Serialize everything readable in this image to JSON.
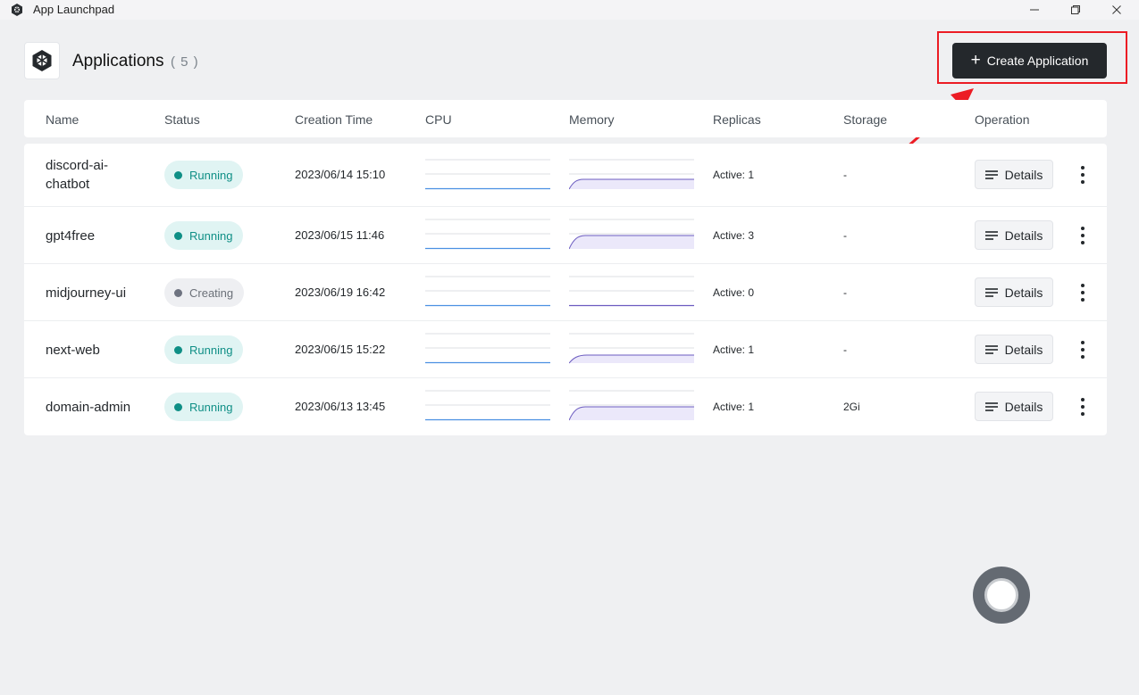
{
  "window": {
    "title": "App Launchpad",
    "icons": {
      "logo": "hexagon-cube-icon",
      "minimize": "minimize-icon",
      "maximize": "restore-icon",
      "close": "close-icon"
    }
  },
  "header": {
    "title": "Applications",
    "count": "( 5 )",
    "create_label": "Create Application",
    "create_icon": "+"
  },
  "table": {
    "columns": [
      "Name",
      "Status",
      "Creation Time",
      "CPU",
      "Memory",
      "Replicas",
      "Storage",
      "Operation"
    ],
    "details_label": "Details",
    "rows": [
      {
        "name": "discord-ai-chatbot",
        "status": "Running",
        "created": "2023/06/14 15:10",
        "replicas": "Active: 1",
        "storage": "-"
      },
      {
        "name": "gpt4free",
        "status": "Running",
        "created": "2023/06/15 11:46",
        "replicas": "Active: 3",
        "storage": "-"
      },
      {
        "name": "midjourney-ui",
        "status": "Creating",
        "created": "2023/06/19 16:42",
        "replicas": "Active: 0",
        "storage": "-"
      },
      {
        "name": "next-web",
        "status": "Running",
        "created": "2023/06/15 15:22",
        "replicas": "Active: 1",
        "storage": "-"
      },
      {
        "name": "domain-admin",
        "status": "Running",
        "created": "2023/06/13 13:45",
        "replicas": "Active: 1",
        "storage": "2Gi"
      }
    ]
  },
  "colors": {
    "running": "#0f8f86",
    "creating": "#6e7380",
    "cpu_line": "#4a90e2",
    "memory_line": "#6b5bc0",
    "annotation": "#ec1c24"
  }
}
